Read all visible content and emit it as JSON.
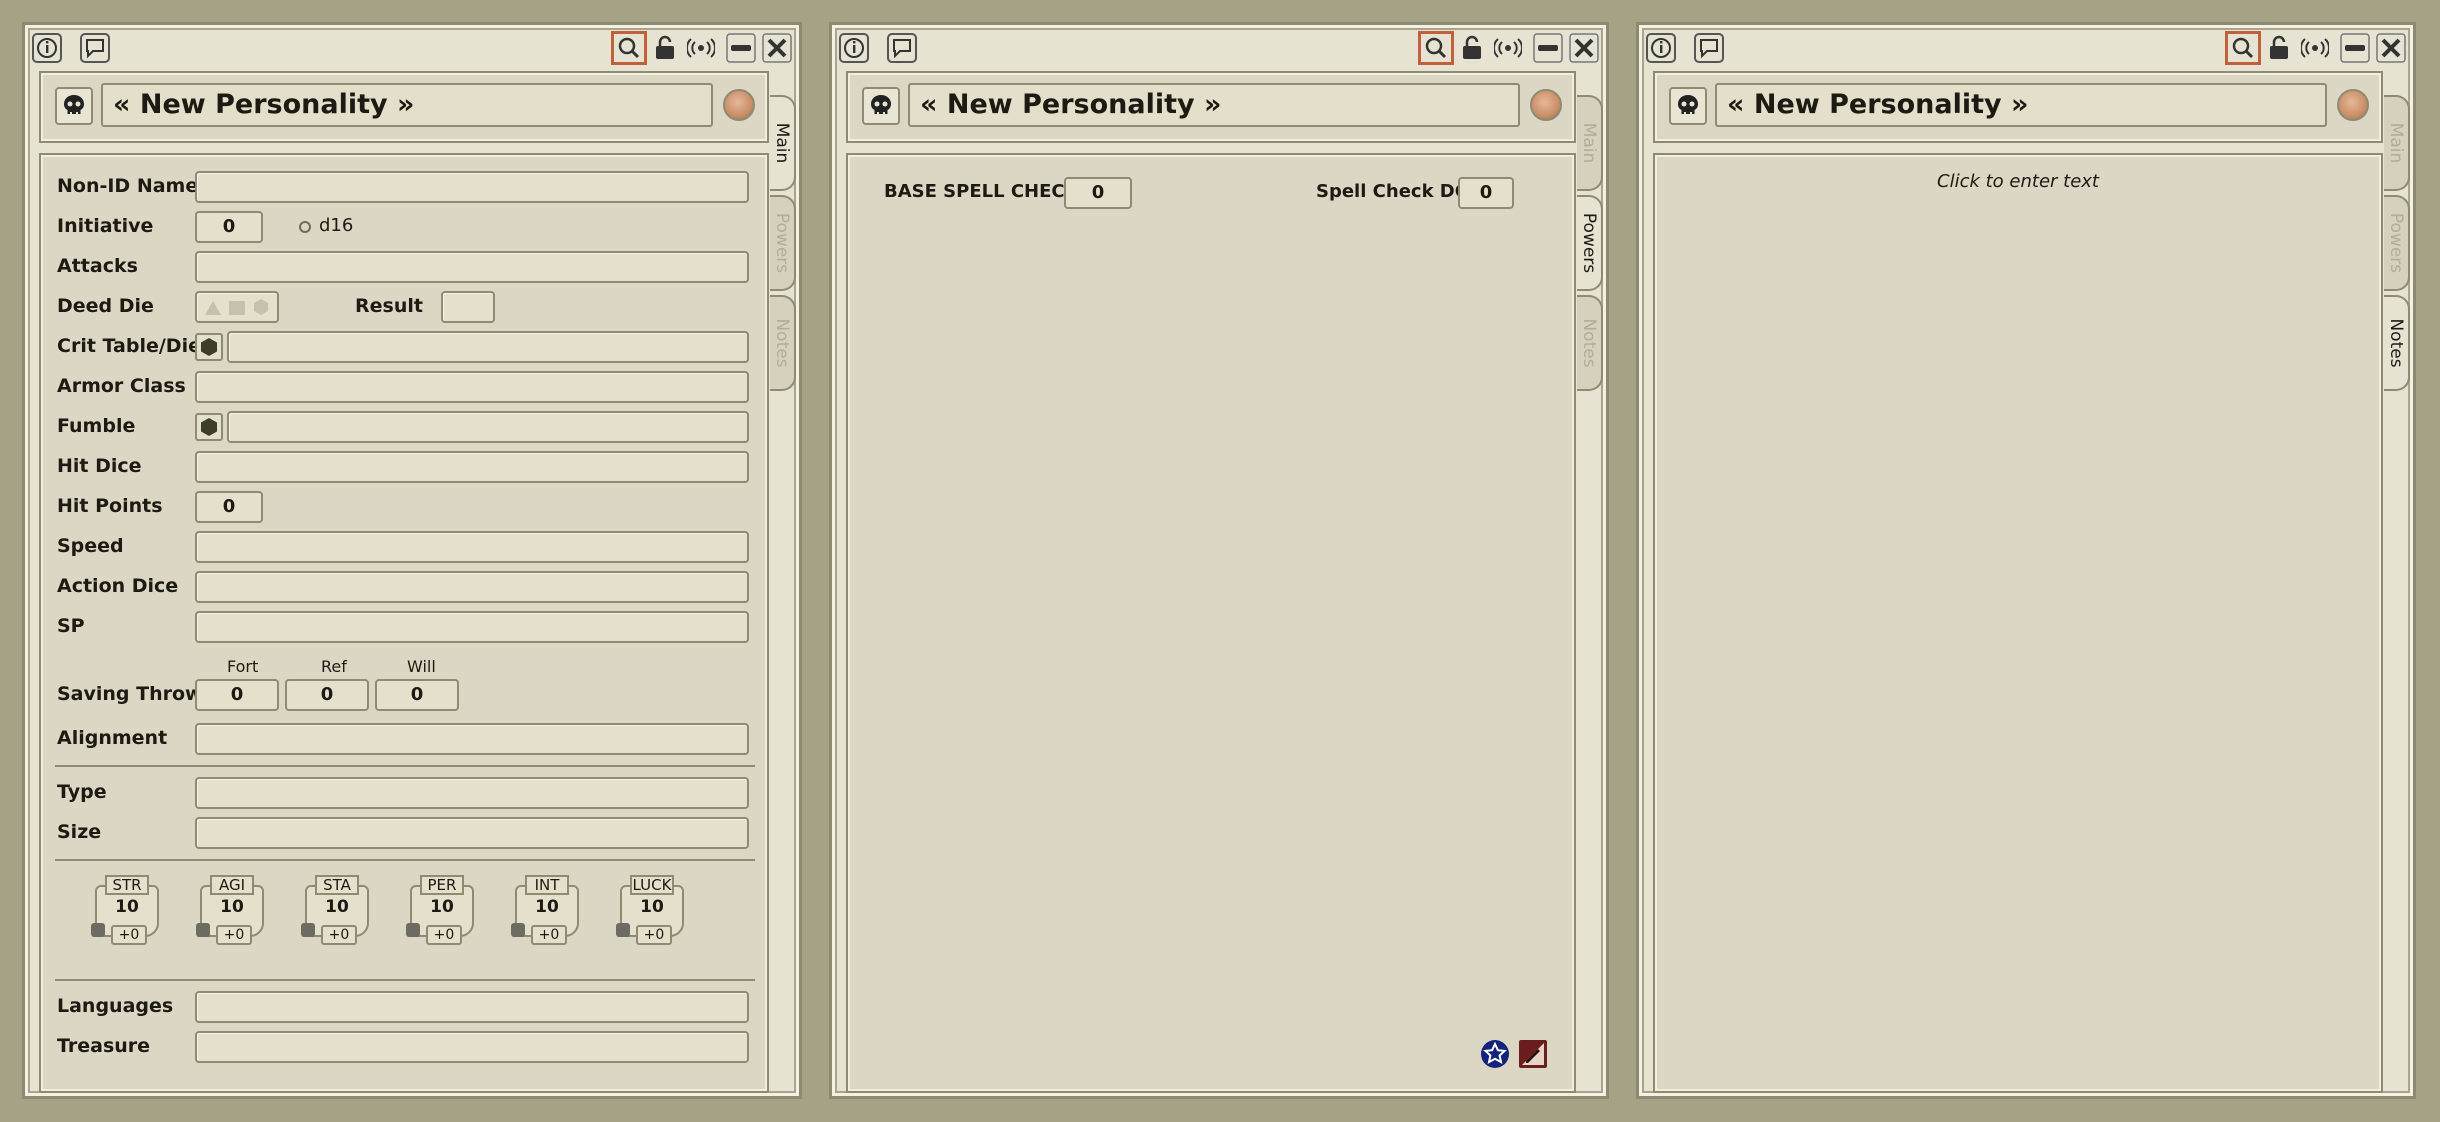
{
  "windows": [
    {
      "title": "« New Personality »",
      "active_tab": "Main"
    },
    {
      "title": "« New Personality »",
      "active_tab": "Powers"
    },
    {
      "title": "« New Personality »",
      "active_tab": "Notes"
    }
  ],
  "tabs": [
    "Main",
    "Powers",
    "Notes"
  ],
  "main": {
    "non_id_name": "Non-ID Name",
    "initiative": "Initiative",
    "initiative_value": "0",
    "initiative_die": "d16",
    "attacks": "Attacks",
    "deed_die": "Deed Die",
    "result": "Result",
    "crit_table": "Crit Table/Die",
    "armor_class": "Armor Class",
    "fumble": "Fumble",
    "hit_dice": "Hit Dice",
    "hit_points": "Hit Points",
    "hit_points_value": "0",
    "speed": "Speed",
    "action_dice": "Action Dice",
    "sp": "SP",
    "saving_throws": "Saving Throws",
    "fort": "Fort",
    "ref": "Ref",
    "will": "Will",
    "fort_value": "0",
    "ref_value": "0",
    "will_value": "0",
    "alignment": "Alignment",
    "type": "Type",
    "size": "Size",
    "languages": "Languages",
    "treasure": "Treasure",
    "abilities": [
      {
        "name": "STR",
        "score": "10",
        "mod": "+0"
      },
      {
        "name": "AGI",
        "score": "10",
        "mod": "+0"
      },
      {
        "name": "STA",
        "score": "10",
        "mod": "+0"
      },
      {
        "name": "PER",
        "score": "10",
        "mod": "+0"
      },
      {
        "name": "INT",
        "score": "10",
        "mod": "+0"
      },
      {
        "name": "LUCK",
        "score": "10",
        "mod": "+0"
      }
    ]
  },
  "powers": {
    "base_spell_check": "BASE SPELL CHECK",
    "base_spell_check_value": "0",
    "spell_check_dc": "Spell Check DC",
    "spell_check_dc_value": "0"
  },
  "notes": {
    "placeholder": "Click to enter text"
  },
  "colors": {
    "background": "#a6a285",
    "panel": "#dcd7c4",
    "accent": "#c0603d"
  }
}
